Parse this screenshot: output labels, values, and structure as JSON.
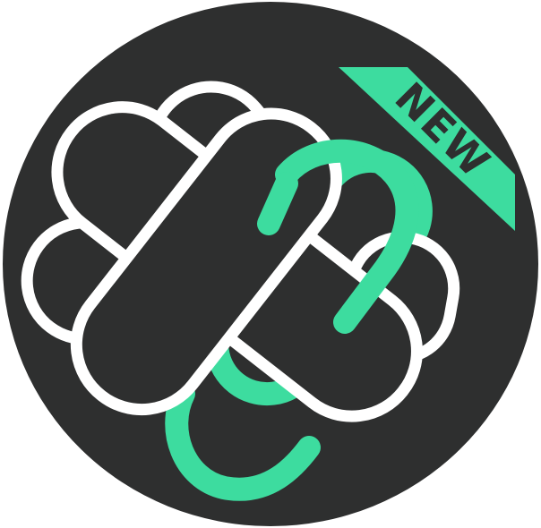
{
  "icon": {
    "badge_label": "NEW",
    "colors": {
      "background": "#2e2f2f",
      "outline": "#ffffff",
      "accent": "#3ddc9f",
      "badge_text": "#2e2f2f"
    }
  }
}
